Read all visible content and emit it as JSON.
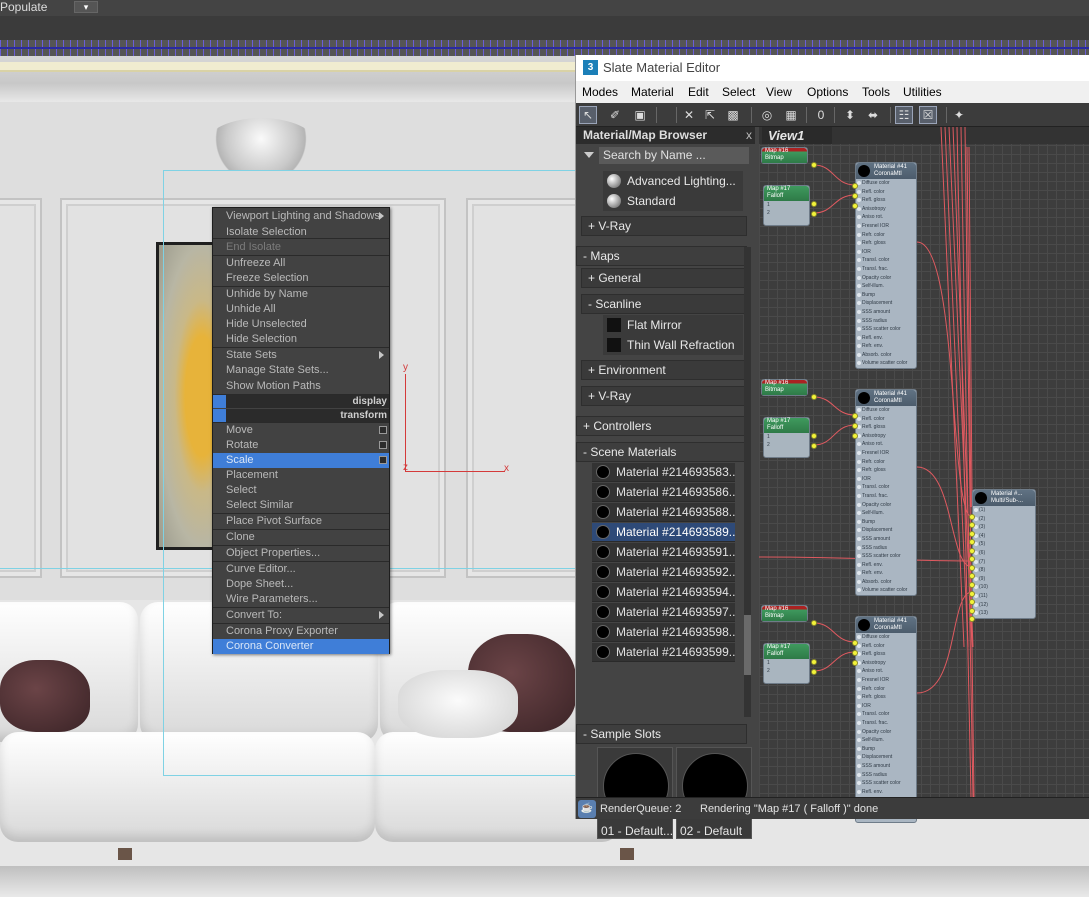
{
  "topbar": {
    "left_text": "Populate",
    "dropdown_glyph": "▾"
  },
  "quad_menu": {
    "items": [
      {
        "label": "Viewport Lighting and Shadows",
        "state": "normal",
        "submenu": true
      },
      {
        "label": "Isolate Selection",
        "state": "normal"
      },
      {
        "label": "End Isolate",
        "state": "dim"
      },
      {
        "label": "Unfreeze All",
        "state": "normal"
      },
      {
        "label": "Freeze Selection",
        "state": "normal"
      },
      {
        "label": "Unhide by Name",
        "state": "normal"
      },
      {
        "label": "Unhide All",
        "state": "normal"
      },
      {
        "label": "Hide Unselected",
        "state": "normal"
      },
      {
        "label": "Hide Selection",
        "state": "normal"
      },
      {
        "label": "State Sets",
        "state": "normal",
        "submenu": true
      },
      {
        "label": "Manage State Sets...",
        "state": "normal"
      },
      {
        "label": "Show Motion Paths",
        "state": "normal"
      },
      {
        "label": "Move",
        "state": "normal",
        "box": true
      },
      {
        "label": "Rotate",
        "state": "normal",
        "box": true
      },
      {
        "label": "Scale",
        "state": "highlight",
        "box": true
      },
      {
        "label": "Placement",
        "state": "normal"
      },
      {
        "label": "Select",
        "state": "normal"
      },
      {
        "label": "Select Similar",
        "state": "normal"
      },
      {
        "label": "Place Pivot Surface",
        "state": "normal"
      },
      {
        "label": "Clone",
        "state": "normal"
      },
      {
        "label": "Object Properties...",
        "state": "normal"
      },
      {
        "label": "Curve Editor...",
        "state": "normal"
      },
      {
        "label": "Dope Sheet...",
        "state": "normal"
      },
      {
        "label": "Wire Parameters...",
        "state": "normal"
      },
      {
        "label": "Convert To:",
        "state": "normal",
        "submenu": true
      },
      {
        "label": "Corona Proxy Exporter",
        "state": "normal"
      },
      {
        "label": "Corona Converter",
        "state": "highlight"
      }
    ],
    "headers": {
      "display": "display",
      "transform": "transform"
    }
  },
  "gizmo": {
    "y_label": "y",
    "x_label": "x",
    "z_label": "z"
  },
  "sme": {
    "title": "Slate Material Editor",
    "logo": "3",
    "menu": [
      "Modes",
      "Material",
      "Edit",
      "Select",
      "View",
      "Options",
      "Tools",
      "Utilities"
    ],
    "toolbar_icons": [
      "select-arrow-icon",
      "eyedropper-icon",
      "assign-material-icon",
      "delete-icon",
      "move-children-icon",
      "hide-unused-icon",
      "background-icon",
      "checker-icon",
      "zero-icon",
      "layout-icon",
      "layout-children-icon",
      "show-browser-icon",
      "show-params-icon",
      "wand-icon"
    ],
    "toolbar_glyphs": [
      "↖",
      "✐",
      "▣",
      "✕",
      "⇱",
      "▩",
      "◎",
      "▦",
      "0",
      "⬍",
      "⬌",
      "☷",
      "☒",
      "✦"
    ],
    "browser": {
      "title": "Material/Map Browser",
      "close": "x",
      "search_placeholder": "Search by Name ...",
      "top_items": [
        {
          "label": "Advanced Lighting..."
        },
        {
          "label": "Standard"
        }
      ],
      "vray1": "+ V-Ray",
      "maps": "- Maps",
      "general": "+ General",
      "scanline": "- Scanline",
      "scanline_items": [
        "Flat Mirror",
        "Thin Wall Refraction"
      ],
      "environment": "+ Environment",
      "vray2": "+ V-Ray",
      "controllers": "+ Controllers",
      "scene_materials": "- Scene Materials",
      "materials": [
        {
          "label": "Material #214693583...",
          "selected": false
        },
        {
          "label": "Material #214693586...",
          "selected": false
        },
        {
          "label": "Material #214693588...",
          "selected": false
        },
        {
          "label": "Material #214693589...",
          "selected": true
        },
        {
          "label": "Material #214693591...",
          "selected": false
        },
        {
          "label": "Material #214693592...",
          "selected": false
        },
        {
          "label": "Material #214693594...",
          "selected": false
        },
        {
          "label": "Material #214693597...",
          "selected": false
        },
        {
          "label": "Material #214693598...",
          "selected": false
        },
        {
          "label": "Material #214693599...",
          "selected": false
        }
      ],
      "sample_slots": "- Sample Slots",
      "slots": [
        "01 - Default...",
        "02 - Default"
      ]
    },
    "view": {
      "tab": "View1",
      "corona_node": {
        "title1": "Material #41",
        "title2": "CoronaMtl",
        "rows": [
          "Diffuse color",
          "Refl. color",
          "Refl. gloss",
          "Anisotropy",
          "Aniso rot.",
          "Fresnel IOR",
          "Refr. color",
          "Refr. gloss",
          "IOR",
          "Transl. color",
          "Transl. frac.",
          "Opacity color",
          "Self-illum.",
          "Bump",
          "Displacement",
          "SSS amount",
          "SSS radius",
          "SSS scatter color",
          "Refl. env.",
          "Refr. env.",
          "Absorb. color",
          "Volume scatter color"
        ]
      },
      "multi_node": {
        "title1": "Material #...",
        "title2": "Multi/Sub-...",
        "rows": [
          "(1)",
          "(2)",
          "(3)",
          "(4)",
          "(5)",
          "(6)",
          "(7)",
          "(8)",
          "(9)",
          "(10)",
          "(11)",
          "(12)",
          "(13)"
        ]
      },
      "map_nodes": [
        {
          "title1": "Map #16",
          "title2": "Bitmap",
          "red": true
        },
        {
          "title1": "Map #17",
          "title2": "Falloff",
          "red": false
        }
      ],
      "map_rows": [
        "1",
        "2"
      ]
    },
    "status": {
      "queue": "RenderQueue: 2",
      "message": "Rendering \"Map #17  ( Falloff )\" done"
    }
  }
}
